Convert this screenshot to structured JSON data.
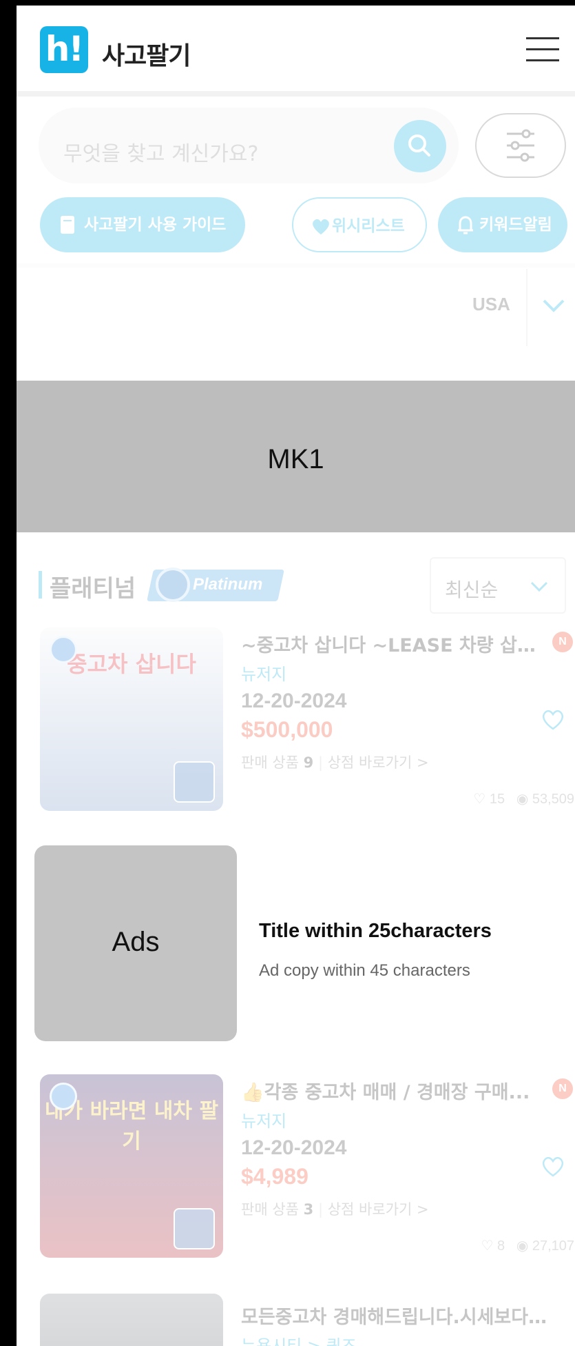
{
  "header": {
    "logo_text": "h!",
    "brand": "사고팔기",
    "menu_icon": "hamburger-icon"
  },
  "search": {
    "placeholder": "무엇을 찾고 계신가요?",
    "search_icon": "search-icon",
    "filter_icon": "sliders-icon"
  },
  "chips": {
    "guide": "사고팔기 사용 가이드",
    "wishlist": "위시리스트",
    "keyword_alert": "키워드알림"
  },
  "region": {
    "selected": "USA"
  },
  "banner": {
    "label": "MK1"
  },
  "section": {
    "title": "플래티넘",
    "badge": "Platinum",
    "sort": "최신순"
  },
  "listings": [
    {
      "thumb_caption": "중고차 삽니다",
      "title": "~중고차 삽니다 ~LEASE 차량 삽...",
      "new_badge": "N",
      "location": "뉴저지",
      "date": "12-20-2024",
      "price": "$500,000",
      "shop_prefix": "판매 상품",
      "shop_count": "9",
      "shop_link": "상점 바로가기 >",
      "likes": "15",
      "views": "53,509",
      "colors": {
        "thumb_top": "#f5f6f8",
        "thumb_bottom": "#7e9cc9"
      }
    },
    {
      "thumb_caption": "내가 바라면 내차 팔기",
      "title": "👍각종 중고차 매매 / 경매장 구매...",
      "new_badge": "N",
      "location": "뉴저지",
      "date": "12-20-2024",
      "price": "$4,989",
      "shop_prefix": "판매 상품",
      "shop_count": "3",
      "shop_link": "상점 바로가기 >",
      "likes": "8",
      "views": "27,107",
      "colors": {
        "thumb_top": "#3b2a6e",
        "thumb_bottom": "#b3262f"
      }
    }
  ],
  "ad": {
    "label": "Ads",
    "title": "Title within 25characters",
    "copy": "Ad copy within 45 characters"
  },
  "last_listing": {
    "title": "모든중고차 경매해드립니다.시세보다 ...",
    "location": "뉴욕시티 > 퀸즈"
  },
  "theme": {
    "accent": "#17b3e6",
    "price": "#ef4b2f",
    "banner_bg": "#bdbdbd"
  }
}
